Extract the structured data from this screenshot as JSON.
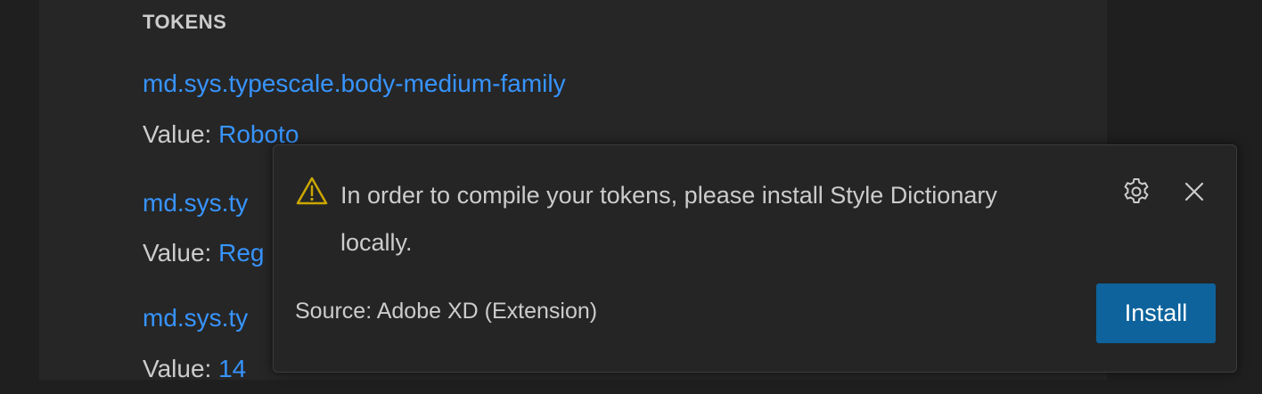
{
  "section": {
    "title": "TOKENS"
  },
  "tokens": [
    {
      "name": "md.sys.typescale.body-medium-family",
      "value_label": "Value:",
      "value": "Roboto"
    },
    {
      "name": "md.sys.ty",
      "value_label": "Value:",
      "value": "Reg"
    },
    {
      "name": "md.sys.ty",
      "value_label": "Value:",
      "value": "14"
    }
  ],
  "notification": {
    "message": "In order to compile your tokens, please install Style Dictionary locally.",
    "source": "Source: Adobe XD (Extension)",
    "install_label": "Install",
    "icons": {
      "severity": "warning-icon",
      "settings": "gear-icon",
      "close": "close-icon"
    }
  },
  "colors": {
    "link": "#3794ff",
    "text": "#cccccc",
    "button": "#0e639c",
    "warning": "#cca700"
  }
}
